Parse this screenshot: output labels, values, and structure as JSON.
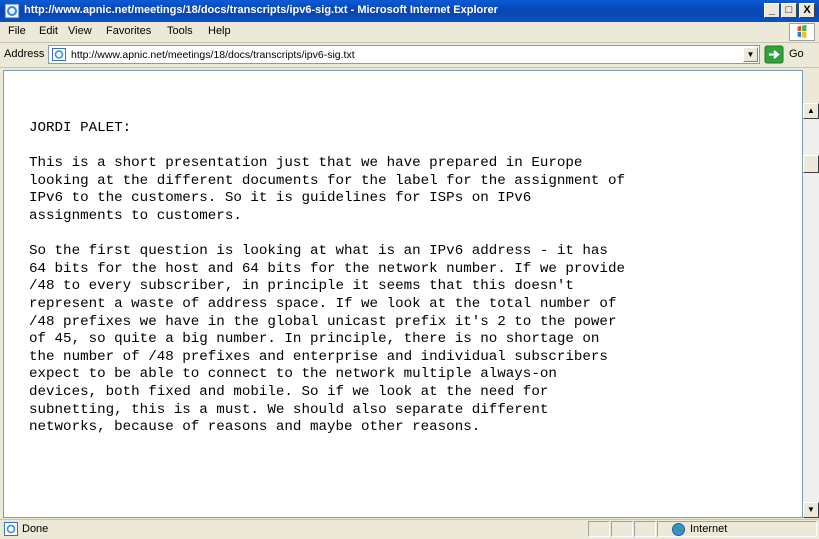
{
  "window": {
    "title": "http://www.apnic.net/meetings/18/docs/transcripts/ipv6-sig.txt - Microsoft Internet Explorer",
    "controls": [
      "_",
      "□",
      "X"
    ]
  },
  "menu": [
    "File",
    "Edit",
    "View",
    "Favorites",
    "Tools",
    "Help"
  ],
  "address_bar": {
    "label": "Address",
    "url": "http://www.apnic.net/meetings/18/docs/transcripts/ipv6-sig.txt",
    "go_label": "Go"
  },
  "document": {
    "paragraphs": [
      "JORDI PALET:",
      "This is a short presentation just that we have prepared in Europe\nlooking at the different documents for the label for the assignment of\nIPv6 to the customers. So it is guidelines for ISPs on IPv6\nassignments to customers.",
      "So the first question is looking at what is an IPv6 address - it has\n64 bits for the host and 64 bits for the network number. If we provide\n/48 to every subscriber, in principle it seems that this doesn't\nrepresent a waste of address space. If we look at the total number of\n/48 prefixes we have in the global unicast prefix it's 2 to the power\nof 45, so quite a big number. In principle, there is no shortage on\nthe number of /48 prefixes and enterprise and individual subscribers\nexpect to be able to connect to the network multiple always-on\ndevices, both fixed and mobile. So if we look at the need for\nsubnetting, this is a must. We should also separate different\nnetworks, because of reasons and maybe other reasons."
    ]
  },
  "status": {
    "text": "Done",
    "zone": "Internet"
  },
  "icons": {
    "title": "ie-page-icon",
    "logo": "windows-flag-icon",
    "address": "page-icon",
    "go": "go-arrow-icon",
    "status": "done-page-icon",
    "zone": "globe-icon"
  },
  "colors": {
    "titlebar": "#0a5bd8",
    "chrome": "#ece9d8",
    "go_green": "#2fa33a"
  }
}
